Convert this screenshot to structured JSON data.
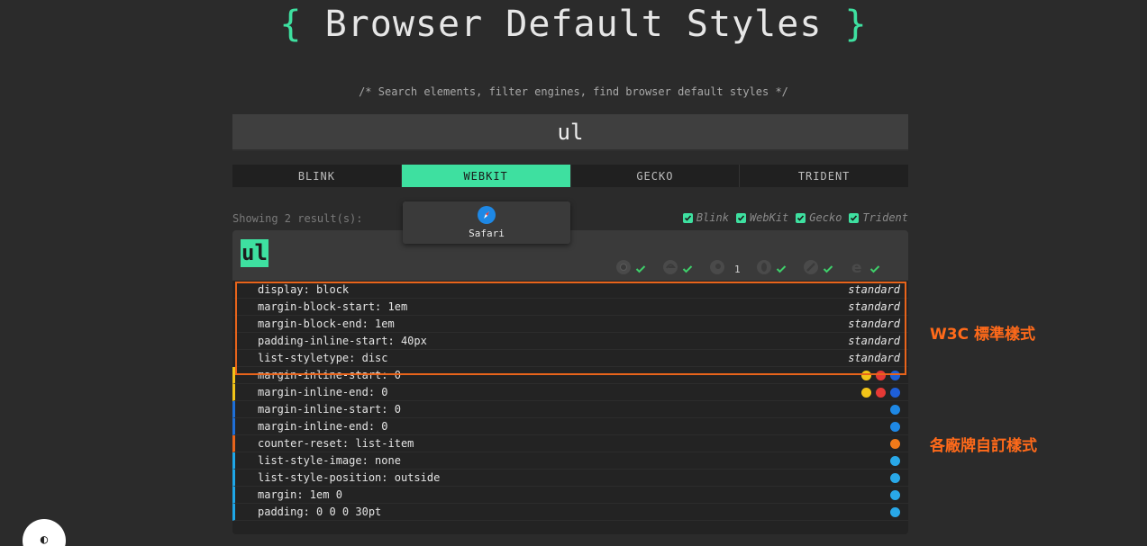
{
  "header": {
    "brace_open": "{",
    "title": "Browser Default Styles",
    "brace_close": "}",
    "subtitle": "/* Search elements, filter engines, find browser default styles */"
  },
  "search": {
    "value": "ul"
  },
  "tabs": [
    {
      "label": "BLINK",
      "active": false
    },
    {
      "label": "WEBKIT",
      "active": true
    },
    {
      "label": "GECKO",
      "active": false
    },
    {
      "label": "TRIDENT",
      "active": false
    }
  ],
  "tooltip": {
    "label": "Safari",
    "icon": "safari-compass-icon"
  },
  "results": {
    "showing": "Showing 2 result(s):"
  },
  "filters": [
    {
      "label": "Blink",
      "checked": true
    },
    {
      "label": "WebKit",
      "checked": true
    },
    {
      "label": "Gecko",
      "checked": true
    },
    {
      "label": "Trident",
      "checked": true
    }
  ],
  "card": {
    "element": "ul",
    "engine_status": [
      {
        "icon": "chrome-icon",
        "status": "check"
      },
      {
        "icon": "edge-legacy-icon",
        "status": "check"
      },
      {
        "icon": "safari-icon",
        "status": "count",
        "count": "1"
      },
      {
        "icon": "opera-icon",
        "status": "check"
      },
      {
        "icon": "firefox-icon",
        "status": "check"
      },
      {
        "icon": "ie-icon",
        "status": "check"
      }
    ],
    "rows": [
      {
        "prop": "display: block",
        "tag": "standard",
        "accent": ""
      },
      {
        "prop": "margin-block-start: 1em",
        "tag": "standard",
        "accent": ""
      },
      {
        "prop": "margin-block-end: 1em",
        "tag": "standard",
        "accent": ""
      },
      {
        "prop": "padding-inline-start: 40px",
        "tag": "standard",
        "accent": ""
      },
      {
        "prop": "list-styletype: disc",
        "tag": "standard",
        "accent": ""
      },
      {
        "prop": "margin-inline-start: 0",
        "tag": "",
        "accent": "#f2c418",
        "icons": [
          "#f2c418",
          "#e53935",
          "#1e5fd8"
        ]
      },
      {
        "prop": "margin-inline-end: 0",
        "tag": "",
        "accent": "#f2c418",
        "icons": [
          "#f2c418",
          "#e53935",
          "#1e5fd8"
        ]
      },
      {
        "prop": "margin-inline-start: 0",
        "tag": "",
        "accent": "#1e6fd8",
        "icons": [
          "#1e88e5"
        ]
      },
      {
        "prop": "margin-inline-end: 0",
        "tag": "",
        "accent": "#1e6fd8",
        "icons": [
          "#1e88e5"
        ]
      },
      {
        "prop": "counter-reset: list-item",
        "tag": "",
        "accent": "#e8641b",
        "icons": [
          "#f07a1a"
        ]
      },
      {
        "prop": "list-style-image: none",
        "tag": "",
        "accent": "#1ea7e8",
        "icons": [
          "#29a8e8"
        ]
      },
      {
        "prop": "list-style-position: outside",
        "tag": "",
        "accent": "#1ea7e8",
        "icons": [
          "#29a8e8"
        ]
      },
      {
        "prop": "margin: 1em 0",
        "tag": "",
        "accent": "#1ea7e8",
        "icons": [
          "#29a8e8"
        ]
      },
      {
        "prop": "padding: 0 0 0 30pt",
        "tag": "",
        "accent": "#1ea7e8",
        "icons": [
          "#29a8e8"
        ]
      }
    ]
  },
  "annotations": {
    "standard": "W3C 標準樣式",
    "vendor": "各廠牌自訂樣式"
  },
  "theme_toggle": {
    "glyph": "◐"
  },
  "colors": {
    "accent": "#3ee0a0",
    "highlight": "#e8641b"
  }
}
